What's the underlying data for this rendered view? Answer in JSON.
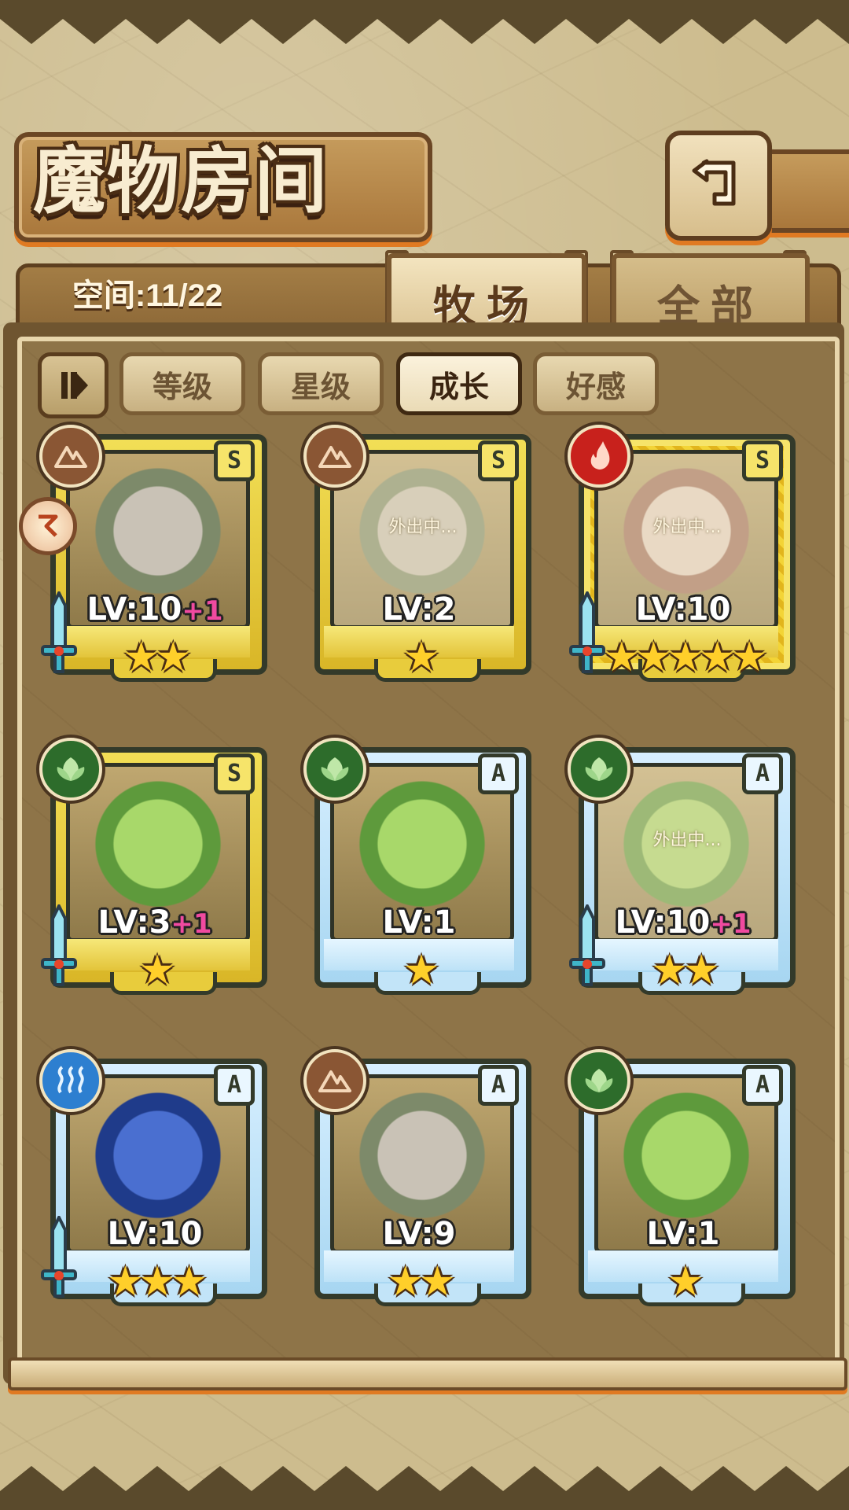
{
  "header": {
    "title": "魔物房间",
    "back_icon": "return-arrow-icon"
  },
  "info": {
    "space_label": "空间:11/22"
  },
  "tabs": [
    {
      "label": "牧场",
      "active": true
    },
    {
      "label": "全部",
      "active": false
    }
  ],
  "filters": {
    "sort_toggle_icon": "sort-toggle-icon",
    "items": [
      {
        "label": "等级",
        "active": false
      },
      {
        "label": "星级",
        "active": false
      },
      {
        "label": "成长",
        "active": true
      },
      {
        "label": "好感",
        "active": false
      }
    ]
  },
  "monsters": [
    {
      "element": "earth",
      "rank": "S",
      "level": "LV:10",
      "bonus": "+1",
      "stars": "★★",
      "status": "",
      "frame": "gold"
    },
    {
      "element": "earth",
      "rank": "S",
      "level": "LV:2",
      "bonus": "",
      "stars": "★",
      "status": "外出中...",
      "frame": "gold"
    },
    {
      "element": "fire",
      "rank": "S",
      "level": "LV:10",
      "bonus": "",
      "stars": "★★★★★",
      "status": "外出中...",
      "frame": "legend"
    },
    {
      "element": "grass",
      "rank": "S",
      "level": "LV:3",
      "bonus": "+1",
      "stars": "★",
      "status": "",
      "frame": "gold"
    },
    {
      "element": "grass",
      "rank": "A",
      "level": "LV:1",
      "bonus": "",
      "stars": "★",
      "status": "",
      "frame": "blue"
    },
    {
      "element": "grass",
      "rank": "A",
      "level": "LV:10",
      "bonus": "+1",
      "stars": "★★",
      "status": "外出中...",
      "frame": "blue"
    },
    {
      "element": "water",
      "rank": "A",
      "level": "LV:10",
      "bonus": "",
      "stars": "★★★",
      "status": "",
      "frame": "blue"
    },
    {
      "element": "earth",
      "rank": "A",
      "level": "LV:9",
      "bonus": "",
      "stars": "★★",
      "status": "",
      "frame": "blue"
    },
    {
      "element": "grass",
      "rank": "A",
      "level": "LV:1",
      "bonus": "",
      "stars": "★",
      "status": "",
      "frame": "blue"
    }
  ],
  "colors": {
    "accent_orange": "#e07a22",
    "parchment": "#cdbc8e",
    "panel": "#8e7448",
    "gold_frame": "#f2df56",
    "blue_frame": "#a7d6f1",
    "bonus_pink": "#f04aa0"
  }
}
